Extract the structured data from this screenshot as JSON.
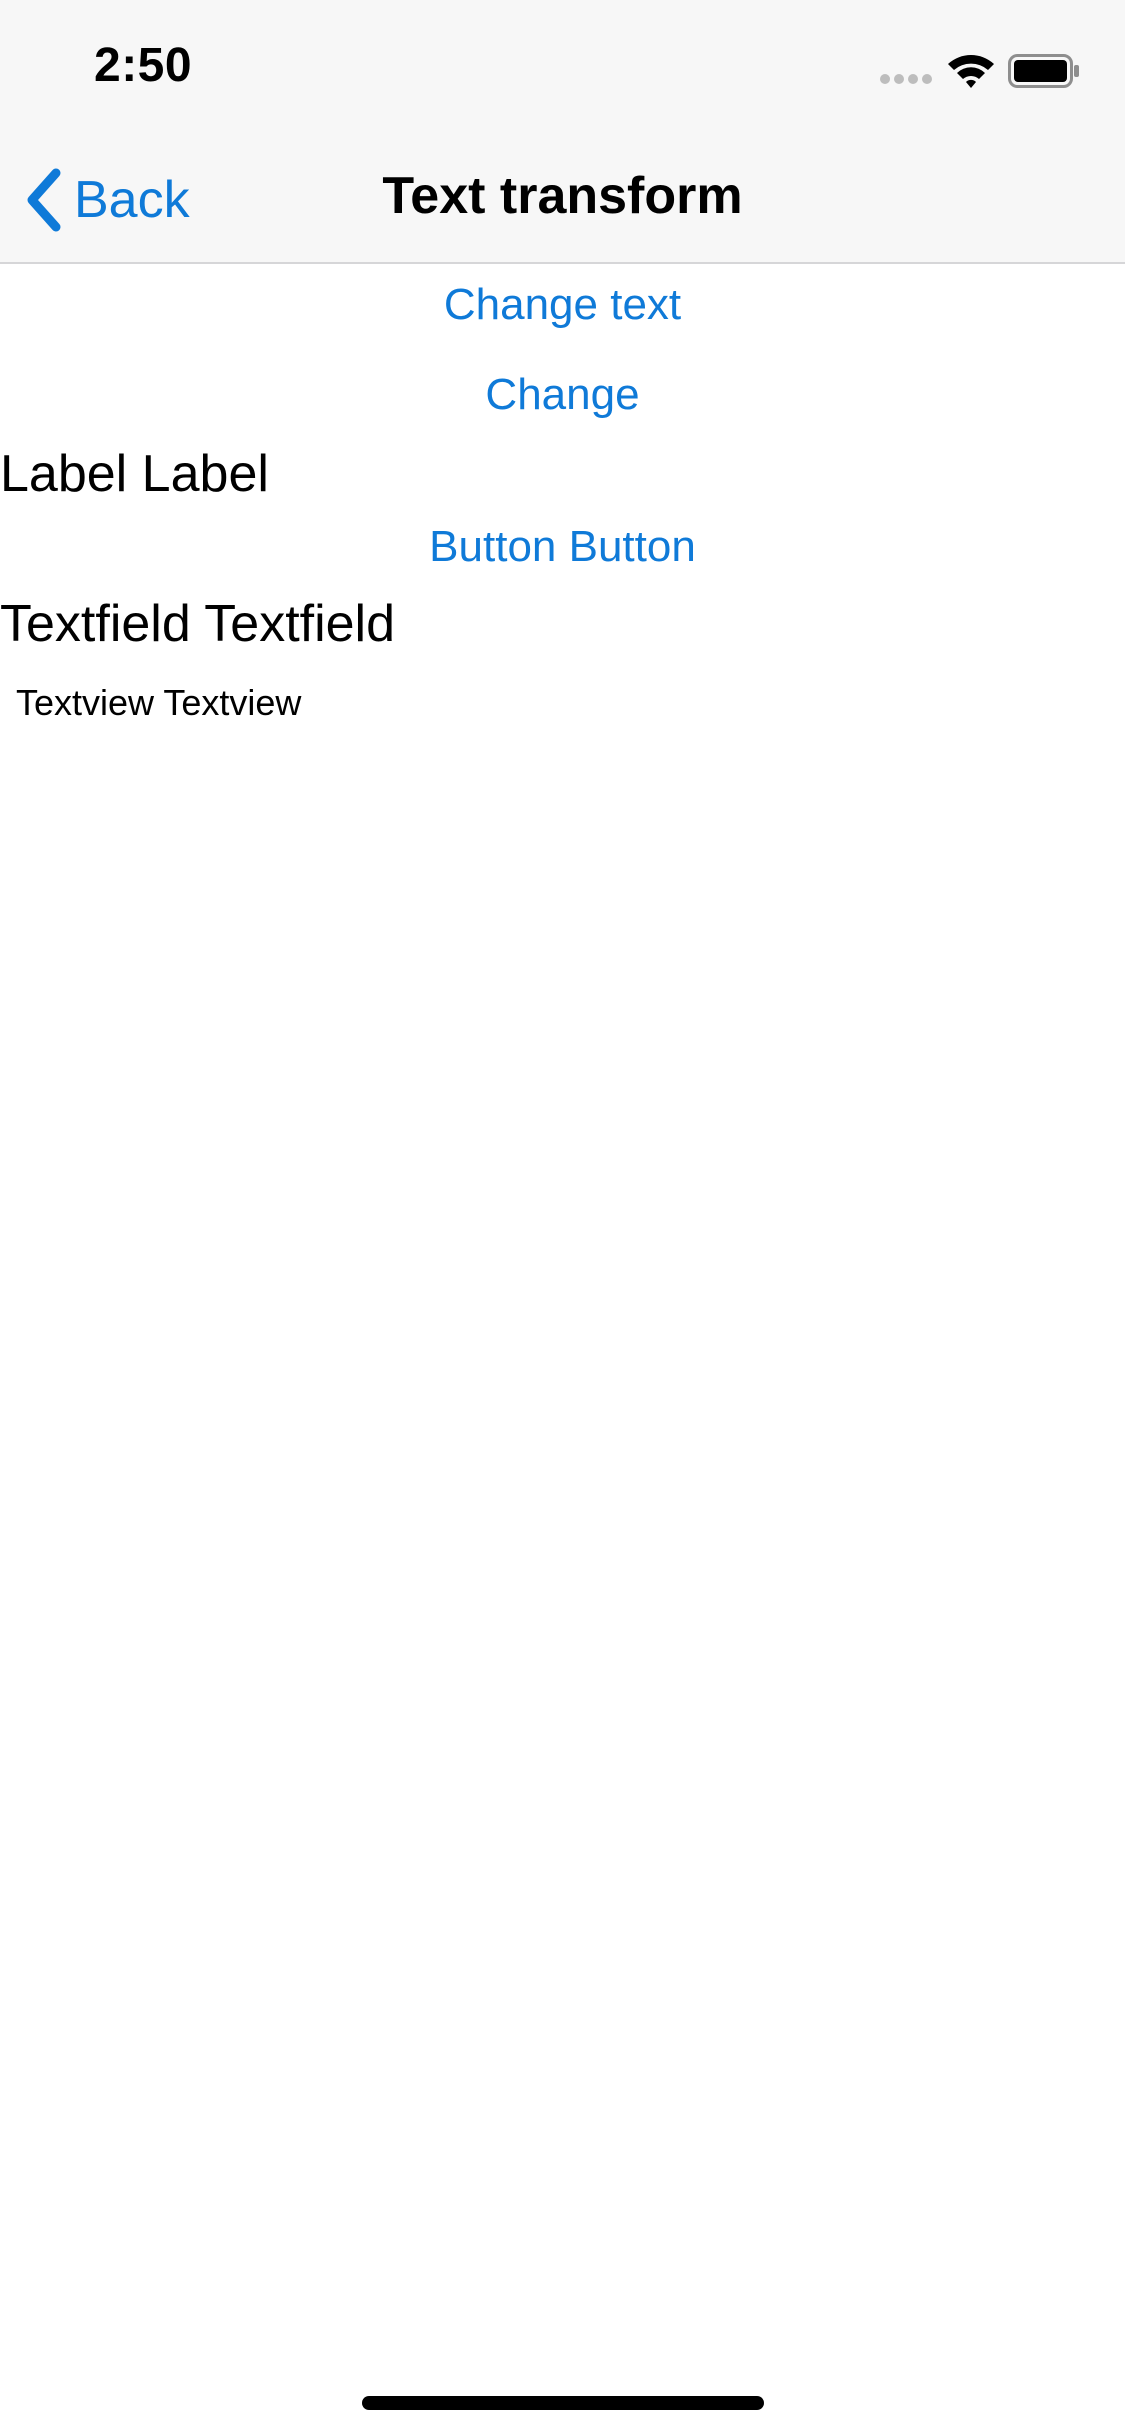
{
  "status_bar": {
    "time": "2:50"
  },
  "nav_bar": {
    "back_label": "Back",
    "title": "Text transform"
  },
  "content": {
    "change_text_button": "Change text",
    "change_button": "Change",
    "label": "Label Label",
    "button": "Button Button",
    "textfield": "Textfield Textfield",
    "textview": "Textview Textview"
  },
  "colors": {
    "accent": "#0f7ad8",
    "nav_background": "#f7f7f7",
    "text": "#000000"
  },
  "icons": {
    "back": "chevron-left-icon",
    "wifi": "wifi-icon",
    "battery": "battery-icon",
    "signal": "signal-icon"
  }
}
